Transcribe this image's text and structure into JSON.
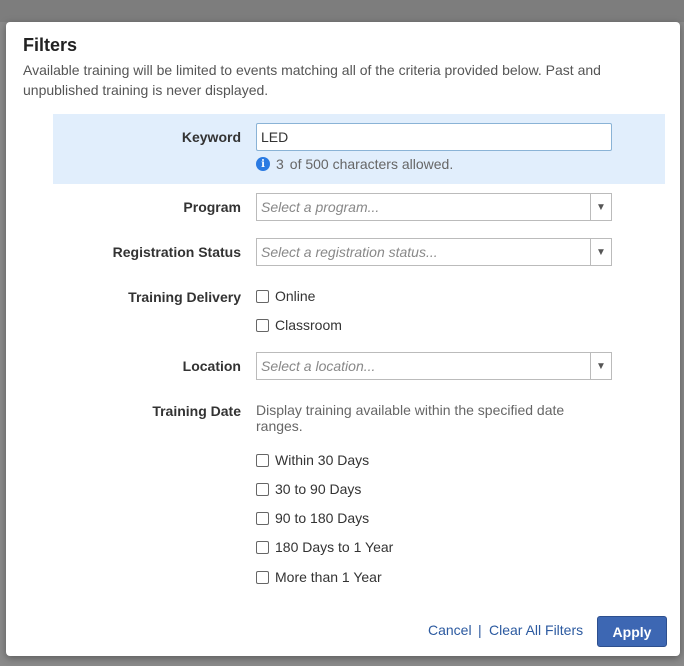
{
  "modal": {
    "title": "Filters",
    "description": "Available training will be limited to events matching all of the criteria provided below. Past and unpublished training is never displayed."
  },
  "keyword": {
    "label": "Keyword",
    "value": "LED",
    "hint_count": "3",
    "hint_text": "of 500 characters allowed.",
    "info_icon": "i"
  },
  "program": {
    "label": "Program",
    "placeholder": "Select a program..."
  },
  "registration_status": {
    "label": "Registration Status",
    "placeholder": "Select a registration status..."
  },
  "training_delivery": {
    "label": "Training Delivery",
    "options": [
      "Online",
      "Classroom"
    ]
  },
  "location": {
    "label": "Location",
    "placeholder": "Select a location..."
  },
  "training_date": {
    "label": "Training Date",
    "note": "Display training available within the specified date ranges.",
    "options": [
      "Within 30 Days",
      "30 to 90 Days",
      "90 to 180 Days",
      "180 Days to 1 Year",
      "More than 1 Year"
    ]
  },
  "footer": {
    "cancel": "Cancel",
    "separator": "|",
    "clear": "Clear All Filters",
    "apply": "Apply"
  },
  "select_arrow": "▼"
}
